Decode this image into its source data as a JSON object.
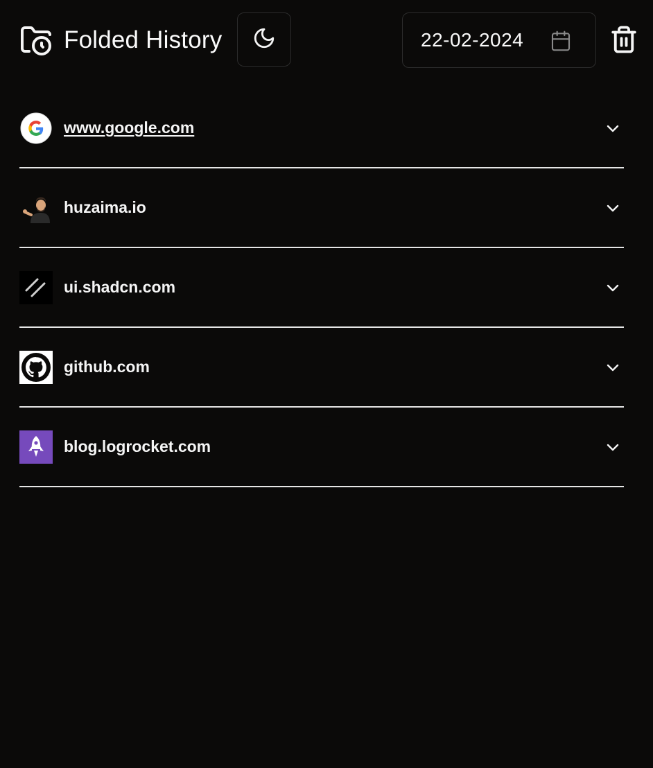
{
  "header": {
    "title": "Folded History",
    "brand_icon": "folder-clock-icon",
    "theme_toggle_icon": "moon-icon",
    "date": "22-02-2024",
    "date_icon": "calendar-icon",
    "delete_icon": "trash-icon"
  },
  "history": [
    {
      "domain": "www.google.com",
      "favicon": "google-icon",
      "underlined": true
    },
    {
      "domain": "huzaima.io",
      "favicon": "avatar-icon",
      "underlined": false
    },
    {
      "domain": "ui.shadcn.com",
      "favicon": "shadcn-icon",
      "underlined": false
    },
    {
      "domain": "github.com",
      "favicon": "github-icon",
      "underlined": false
    },
    {
      "domain": "blog.logrocket.com",
      "favicon": "logrocket-icon",
      "underlined": false
    }
  ],
  "colors": {
    "background": "#0b0a09",
    "foreground": "#f5f5f5",
    "border": "#2c2c2c",
    "divider": "#e6e6e6",
    "logrocket_purple": "#764abc"
  }
}
